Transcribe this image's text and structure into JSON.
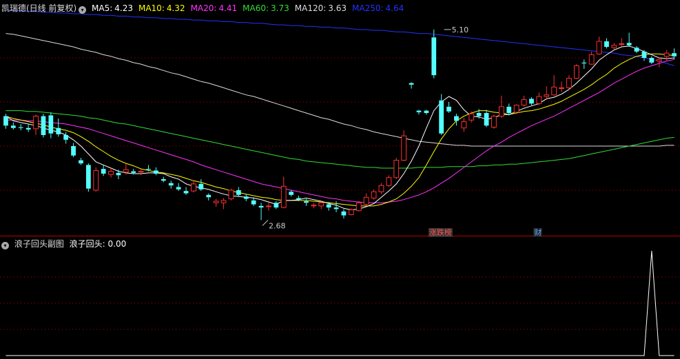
{
  "header": {
    "title": "凯瑞德(日线 前复权)",
    "ma": [
      {
        "label": "MA5:",
        "value": "4.23",
        "color": "#ffffff"
      },
      {
        "label": "MA10:",
        "value": "4.32",
        "color": "#ffff00"
      },
      {
        "label": "MA20:",
        "value": "4.41",
        "color": "#ff33ff"
      },
      {
        "label": "MA60:",
        "value": "3.73",
        "color": "#33dd33"
      },
      {
        "label": "MA120:",
        "value": "3.63",
        "color": "#dddddd"
      },
      {
        "label": "MA250:",
        "value": "4.64",
        "color": "#2233ff"
      }
    ]
  },
  "sub": {
    "title": "浪子回头副图",
    "indicator_label": "浪子回头:",
    "indicator_value": "0.00"
  },
  "events": [
    {
      "label": "涨跌榜",
      "color": "#ff5555",
      "bg": "#333333",
      "index": 57
    },
    {
      "label": "财",
      "color": "#66aaff",
      "bg": "#222222",
      "index": 71
    }
  ],
  "colors": {
    "up": "#ff3030",
    "down": "#54ffff",
    "ma5": "#ffffff",
    "ma10": "#ffff00",
    "ma20": "#ff33ff",
    "ma60": "#33dd33",
    "ma120": "#dddddd",
    "ma250": "#2233ff",
    "grid": "#c00000"
  },
  "chart_data": [
    {
      "type": "candlestick",
      "title": "凯瑞德(日线 前复权)",
      "ylim": [
        2.5,
        5.3
      ],
      "annotations": [
        {
          "text": "5.10",
          "index": 58,
          "value": 5.1,
          "kind": "high"
        },
        {
          "text": "2.68",
          "index": 34,
          "value": 2.68,
          "kind": "low"
        }
      ],
      "ohlc": [
        [
          4.0,
          4.03,
          3.84,
          3.88
        ],
        [
          3.88,
          3.92,
          3.83,
          3.85
        ],
        [
          3.86,
          3.9,
          3.82,
          3.85
        ],
        [
          3.85,
          3.89,
          3.8,
          3.83
        ],
        [
          3.84,
          4.02,
          3.76,
          4.0
        ],
        [
          4.0,
          4.03,
          3.73,
          3.76
        ],
        [
          4.01,
          4.05,
          3.72,
          3.78
        ],
        [
          3.85,
          3.97,
          3.74,
          3.77
        ],
        [
          3.76,
          3.8,
          3.65,
          3.7
        ],
        [
          3.62,
          3.66,
          3.48,
          3.5
        ],
        [
          3.44,
          3.47,
          3.38,
          3.4
        ],
        [
          3.38,
          3.4,
          3.04,
          3.08
        ],
        [
          3.06,
          3.35,
          3.04,
          3.31
        ],
        [
          3.33,
          3.38,
          3.24,
          3.27
        ],
        [
          3.26,
          3.34,
          3.22,
          3.3
        ],
        [
          3.28,
          3.32,
          3.2,
          3.25
        ],
        [
          3.29,
          3.4,
          3.26,
          3.32
        ],
        [
          3.3,
          3.33,
          3.26,
          3.28
        ],
        [
          3.29,
          3.32,
          3.25,
          3.3
        ],
        [
          3.33,
          3.38,
          3.3,
          3.32
        ],
        [
          3.31,
          3.35,
          3.25,
          3.27
        ],
        [
          3.2,
          3.23,
          3.16,
          3.18
        ],
        [
          3.15,
          3.18,
          3.08,
          3.12
        ],
        [
          3.1,
          3.15,
          3.05,
          3.07
        ],
        [
          3.05,
          3.1,
          3.0,
          3.02
        ],
        [
          3.05,
          3.18,
          3.03,
          3.14
        ],
        [
          3.14,
          3.2,
          3.05,
          3.07
        ],
        [
          3.0,
          3.02,
          2.93,
          2.97
        ],
        [
          2.9,
          2.95,
          2.85,
          2.92
        ],
        [
          2.9,
          2.96,
          2.82,
          2.93
        ],
        [
          2.95,
          3.08,
          2.93,
          3.06
        ],
        [
          3.06,
          3.1,
          2.98,
          3.0
        ],
        [
          2.98,
          3.01,
          2.92,
          2.95
        ],
        [
          2.93,
          2.97,
          2.86,
          2.88
        ],
        [
          2.86,
          2.9,
          2.68,
          2.84
        ],
        [
          2.85,
          2.9,
          2.8,
          2.86
        ],
        [
          2.9,
          2.92,
          2.82,
          2.84
        ],
        [
          2.84,
          3.23,
          2.83,
          3.11
        ],
        [
          3.04,
          3.06,
          2.98,
          3.0
        ],
        [
          2.96,
          2.99,
          2.92,
          2.94
        ],
        [
          2.92,
          2.95,
          2.86,
          2.9
        ],
        [
          2.86,
          2.9,
          2.83,
          2.87
        ],
        [
          2.86,
          2.92,
          2.82,
          2.9
        ],
        [
          2.88,
          2.91,
          2.8,
          2.84
        ],
        [
          2.84,
          2.92,
          2.78,
          2.82
        ],
        [
          2.79,
          2.82,
          2.7,
          2.74
        ],
        [
          2.75,
          2.83,
          2.74,
          2.81
        ],
        [
          2.8,
          2.92,
          2.79,
          2.9
        ],
        [
          2.88,
          3.02,
          2.86,
          2.97
        ],
        [
          2.96,
          3.07,
          2.94,
          3.04
        ],
        [
          3.04,
          3.15,
          3.01,
          3.12
        ],
        [
          3.12,
          3.25,
          3.1,
          3.22
        ],
        [
          3.22,
          3.47,
          3.2,
          3.44
        ],
        [
          3.44,
          3.82,
          3.43,
          3.75
        ],
        [
          4.42,
          4.43,
          4.35,
          4.4
        ],
        [
          4.07,
          4.08,
          4.02,
          4.05
        ],
        [
          4.07,
          4.08,
          4.02,
          4.04
        ],
        [
          5.0,
          5.1,
          4.48,
          4.52
        ],
        [
          4.2,
          4.28,
          3.76,
          3.78
        ],
        [
          4.12,
          4.18,
          4.04,
          4.06
        ],
        [
          4.0,
          4.03,
          3.88,
          3.94
        ],
        [
          3.85,
          3.98,
          3.8,
          3.93
        ],
        [
          3.95,
          4.06,
          3.92,
          4.03
        ],
        [
          4.04,
          4.09,
          3.97,
          4.0
        ],
        [
          4.04,
          4.08,
          3.86,
          3.88
        ],
        [
          3.86,
          4.02,
          3.84,
          4.0
        ],
        [
          4.0,
          4.26,
          3.98,
          4.12
        ],
        [
          4.12,
          4.16,
          4.01,
          4.04
        ],
        [
          4.05,
          4.15,
          4.04,
          4.14
        ],
        [
          4.14,
          4.26,
          4.12,
          4.21
        ],
        [
          4.22,
          4.24,
          4.14,
          4.16
        ],
        [
          4.16,
          4.3,
          4.14,
          4.25
        ],
        [
          4.25,
          4.38,
          4.21,
          4.27
        ],
        [
          4.27,
          4.52,
          4.26,
          4.37
        ],
        [
          4.36,
          4.44,
          4.31,
          4.36
        ],
        [
          4.36,
          4.52,
          4.34,
          4.48
        ],
        [
          4.48,
          4.66,
          4.47,
          4.64
        ],
        [
          4.68,
          4.72,
          4.6,
          4.67
        ],
        [
          4.66,
          4.82,
          4.65,
          4.78
        ],
        [
          4.79,
          5.01,
          4.78,
          4.95
        ],
        [
          4.95,
          4.99,
          4.86,
          4.88
        ],
        [
          4.87,
          4.93,
          4.84,
          4.9
        ],
        [
          4.91,
          4.99,
          4.89,
          4.92
        ],
        [
          4.93,
          5.06,
          4.88,
          4.9
        ],
        [
          4.87,
          4.89,
          4.8,
          4.82
        ],
        [
          4.82,
          4.84,
          4.7,
          4.74
        ],
        [
          4.74,
          4.76,
          4.66,
          4.68
        ],
        [
          4.7,
          4.75,
          4.62,
          4.72
        ],
        [
          4.76,
          4.84,
          4.7,
          4.8
        ],
        [
          4.8,
          4.86,
          4.72,
          4.76
        ]
      ],
      "ma_series": {
        "MA5": [
          4.0,
          3.94,
          3.92,
          3.9,
          3.88,
          3.85,
          3.82,
          3.8,
          3.76,
          3.7,
          3.62,
          3.52,
          3.42,
          3.38,
          3.34,
          3.3,
          3.28,
          3.27,
          3.27,
          3.28,
          3.28,
          3.27,
          3.23,
          3.2,
          3.14,
          3.11,
          3.09,
          3.07,
          3.04,
          3.01,
          2.99,
          2.98,
          2.97,
          2.96,
          2.94,
          2.91,
          2.88,
          2.93,
          2.93,
          2.94,
          2.96,
          2.94,
          2.92,
          2.89,
          2.87,
          2.83,
          2.81,
          2.82,
          2.85,
          2.89,
          2.97,
          3.05,
          3.14,
          3.27,
          3.43,
          3.62,
          3.85,
          4.07,
          4.18,
          4.25,
          4.2,
          4.08,
          4.0,
          3.99,
          3.96,
          3.98,
          4.02,
          4.02,
          4.06,
          4.1,
          4.13,
          4.16,
          4.22,
          4.24,
          4.28,
          4.34,
          4.42,
          4.51,
          4.6,
          4.71,
          4.78,
          4.84,
          4.88,
          4.89,
          4.86,
          4.82,
          4.78,
          4.74,
          4.73,
          4.74
        ],
        "MA10": [
          4.0,
          3.97,
          3.95,
          3.93,
          3.91,
          3.89,
          3.86,
          3.84,
          3.82,
          3.79,
          3.74,
          3.68,
          3.61,
          3.55,
          3.49,
          3.44,
          3.4,
          3.37,
          3.33,
          3.31,
          3.29,
          3.28,
          3.26,
          3.24,
          3.21,
          3.18,
          3.16,
          3.13,
          3.1,
          3.08,
          3.05,
          3.03,
          3.01,
          2.99,
          2.97,
          2.96,
          2.94,
          2.93,
          2.93,
          2.93,
          2.93,
          2.92,
          2.91,
          2.9,
          2.89,
          2.88,
          2.87,
          2.86,
          2.86,
          2.86,
          2.88,
          2.91,
          2.95,
          3.02,
          3.11,
          3.22,
          3.38,
          3.55,
          3.71,
          3.84,
          3.94,
          4.0,
          4.04,
          4.07,
          4.07,
          4.05,
          4.04,
          4.02,
          4.04,
          4.06,
          4.07,
          4.09,
          4.12,
          4.15,
          4.19,
          4.24,
          4.29,
          4.34,
          4.4,
          4.47,
          4.53,
          4.61,
          4.67,
          4.72,
          4.76,
          4.78,
          4.79,
          4.79,
          4.78,
          4.77
        ],
        "MA20": [
          3.95,
          3.95,
          3.95,
          3.94,
          3.94,
          3.93,
          3.92,
          3.91,
          3.9,
          3.88,
          3.86,
          3.84,
          3.81,
          3.78,
          3.75,
          3.72,
          3.69,
          3.66,
          3.63,
          3.6,
          3.57,
          3.54,
          3.51,
          3.48,
          3.45,
          3.42,
          3.38,
          3.35,
          3.32,
          3.29,
          3.26,
          3.23,
          3.2,
          3.17,
          3.14,
          3.12,
          3.1,
          3.08,
          3.06,
          3.04,
          3.02,
          3.0,
          2.98,
          2.96,
          2.95,
          2.93,
          2.92,
          2.91,
          2.9,
          2.9,
          2.9,
          2.91,
          2.92,
          2.94,
          2.97,
          3.0,
          3.04,
          3.09,
          3.15,
          3.21,
          3.28,
          3.35,
          3.42,
          3.49,
          3.56,
          3.62,
          3.67,
          3.73,
          3.78,
          3.83,
          3.88,
          3.92,
          3.96,
          4.0,
          4.05,
          4.1,
          4.15,
          4.2,
          4.25,
          4.3,
          4.36,
          4.42,
          4.47,
          4.52,
          4.57,
          4.61,
          4.64,
          4.67,
          4.7,
          4.72
        ],
        "MA60": [
          4.07,
          4.07,
          4.07,
          4.06,
          4.06,
          4.05,
          4.04,
          4.03,
          4.02,
          4.01,
          4.0,
          3.98,
          3.97,
          3.95,
          3.93,
          3.91,
          3.9,
          3.88,
          3.86,
          3.84,
          3.82,
          3.8,
          3.78,
          3.76,
          3.74,
          3.72,
          3.7,
          3.68,
          3.66,
          3.64,
          3.62,
          3.6,
          3.58,
          3.56,
          3.54,
          3.52,
          3.5,
          3.48,
          3.46,
          3.45,
          3.43,
          3.42,
          3.41,
          3.4,
          3.39,
          3.38,
          3.37,
          3.36,
          3.35,
          3.35,
          3.34,
          3.34,
          3.34,
          3.34,
          3.34,
          3.35,
          3.35,
          3.35,
          3.35,
          3.36,
          3.36,
          3.36,
          3.36,
          3.37,
          3.37,
          3.38,
          3.38,
          3.39,
          3.39,
          3.4,
          3.41,
          3.42,
          3.43,
          3.44,
          3.45,
          3.46,
          3.48,
          3.5,
          3.52,
          3.54,
          3.56,
          3.58,
          3.6,
          3.62,
          3.64,
          3.66,
          3.68,
          3.7,
          3.72,
          3.73
        ],
        "MA120": [
          5.05,
          5.04,
          5.02,
          5.0,
          4.98,
          4.96,
          4.94,
          4.92,
          4.9,
          4.88,
          4.85,
          4.83,
          4.81,
          4.78,
          4.76,
          4.73,
          4.71,
          4.68,
          4.66,
          4.63,
          4.61,
          4.58,
          4.55,
          4.53,
          4.5,
          4.47,
          4.44,
          4.42,
          4.39,
          4.36,
          4.33,
          4.3,
          4.27,
          4.25,
          4.22,
          4.19,
          4.16,
          4.13,
          4.1,
          4.07,
          4.04,
          4.01,
          3.98,
          3.96,
          3.93,
          3.9,
          3.88,
          3.85,
          3.83,
          3.8,
          3.78,
          3.76,
          3.74,
          3.72,
          3.7,
          3.68,
          3.67,
          3.66,
          3.65,
          3.64,
          3.63,
          3.63,
          3.62,
          3.62,
          3.62,
          3.62,
          3.62,
          3.62,
          3.62,
          3.62,
          3.62,
          3.62,
          3.62,
          3.62,
          3.62,
          3.62,
          3.62,
          3.62,
          3.62,
          3.62,
          3.62,
          3.62,
          3.62,
          3.62,
          3.62,
          3.62,
          3.62,
          3.62,
          3.63,
          3.63
        ],
        "MA250": [
          5.35,
          5.34,
          5.34,
          5.33,
          5.33,
          5.32,
          5.32,
          5.31,
          5.31,
          5.3,
          5.3,
          5.29,
          5.29,
          5.28,
          5.28,
          5.27,
          5.27,
          5.26,
          5.26,
          5.25,
          5.25,
          5.24,
          5.24,
          5.23,
          5.23,
          5.22,
          5.22,
          5.21,
          5.21,
          5.2,
          5.2,
          5.19,
          5.19,
          5.18,
          5.18,
          5.17,
          5.16,
          5.16,
          5.15,
          5.15,
          5.14,
          5.14,
          5.13,
          5.13,
          5.12,
          5.12,
          5.11,
          5.1,
          5.1,
          5.09,
          5.09,
          5.08,
          5.07,
          5.07,
          5.06,
          5.05,
          5.05,
          5.04,
          5.03,
          5.02,
          5.01,
          5.0,
          4.99,
          4.98,
          4.97,
          4.96,
          4.95,
          4.94,
          4.93,
          4.92,
          4.91,
          4.9,
          4.89,
          4.88,
          4.87,
          4.86,
          4.85,
          4.84,
          4.83,
          4.82,
          4.81,
          4.8,
          4.78,
          4.77,
          4.76,
          4.74,
          4.72,
          4.7,
          4.67,
          4.64
        ]
      }
    },
    {
      "type": "line",
      "title": "浪子回头副图",
      "ylim": [
        0,
        1
      ],
      "series": [
        {
          "name": "浪子回头",
          "x_start": 0,
          "values": [
            0,
            0,
            0,
            0,
            0,
            0,
            0,
            0,
            0,
            0,
            0,
            0,
            0,
            0,
            0,
            0,
            0,
            0,
            0,
            0,
            0,
            0,
            0,
            0,
            0,
            0,
            0,
            0,
            0,
            0,
            0,
            0,
            0,
            0,
            0,
            0,
            0,
            0,
            0,
            0,
            0,
            0,
            0,
            0,
            0,
            0,
            0,
            0,
            0,
            0,
            0,
            0,
            0,
            0,
            0,
            0,
            0,
            0,
            0,
            0,
            0,
            0,
            0,
            0,
            0,
            0,
            0,
            0,
            0,
            0,
            0,
            0,
            0,
            0,
            0,
            0,
            0,
            0,
            0,
            0,
            0,
            0,
            0,
            0,
            0,
            0,
            1,
            0,
            0,
            0
          ]
        }
      ]
    }
  ]
}
